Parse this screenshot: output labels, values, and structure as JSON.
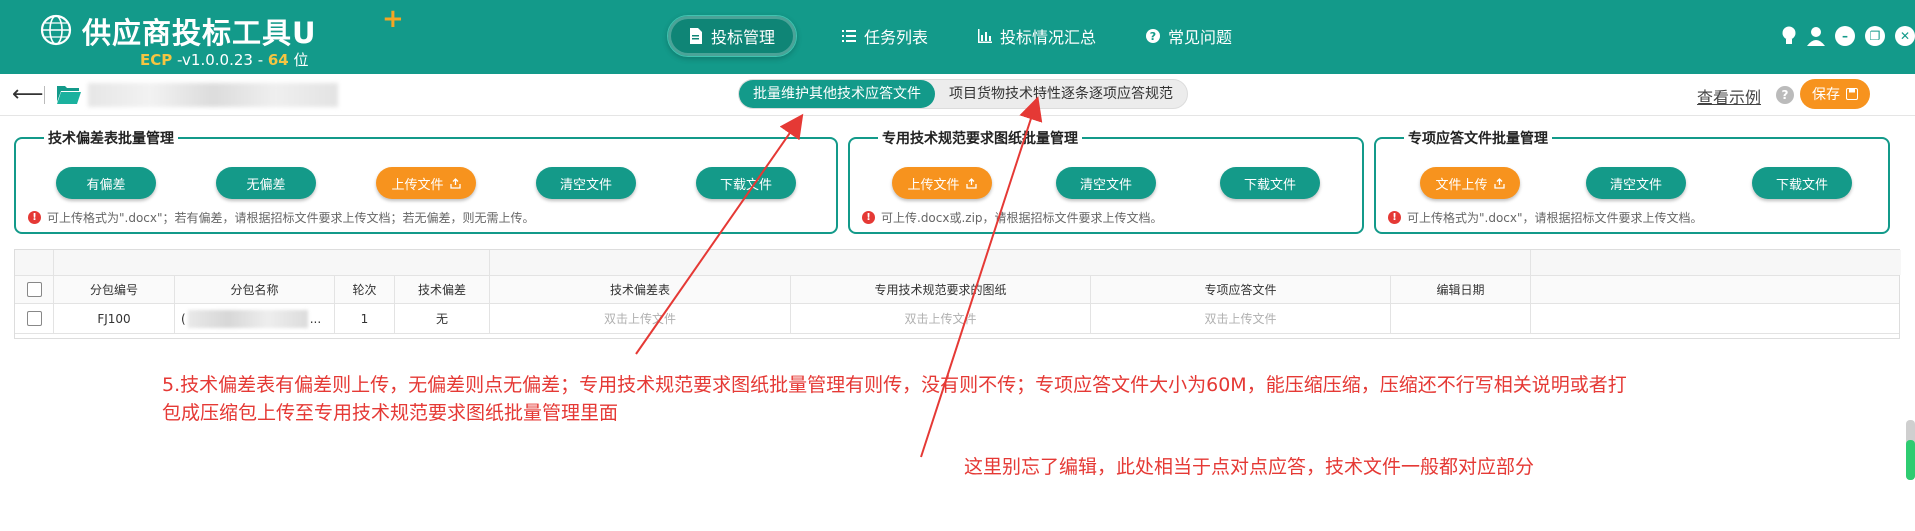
{
  "app": {
    "title": "供应商投标工具U",
    "plus": "+",
    "version_prefix": "ECP",
    "version_number": " -v1.0.0.23 - ",
    "version_bits": "64",
    "version_suffix": " 位"
  },
  "nav": {
    "items": [
      {
        "label": "投标管理",
        "icon": "document-icon"
      },
      {
        "label": "任务列表",
        "icon": "list-icon"
      },
      {
        "label": "投标情况汇总",
        "icon": "bar-chart-icon"
      },
      {
        "label": "常见问题",
        "icon": "question-icon"
      }
    ]
  },
  "toolbar": {
    "tab_active": "批量维护其他技术应答文件",
    "tab_other": "项目货物技术特性逐条逐项应答规范",
    "view_example": "查看示例",
    "save_label": "保存"
  },
  "groups": [
    {
      "title": "技术偏差表批量管理",
      "buttons": [
        "有偏差",
        "无偏差",
        "上传文件",
        "清空文件",
        "下载文件"
      ],
      "note": "可上传格式为\".docx\"；若有偏差，请根据招标文件要求上传文档；若无偏差，则无需上传。"
    },
    {
      "title": "专用技术规范要求图纸批量管理",
      "buttons": [
        "上传文件",
        "清空文件",
        "下载文件"
      ],
      "note": "可上传.docx或.zip，请根据招标文件要求上传文档。"
    },
    {
      "title": "专项应答文件批量管理",
      "buttons": [
        "文件上传",
        "清空文件",
        "下载文件"
      ],
      "note": "可上传格式为\".docx\"，请根据招标文件要求上传文档。"
    }
  ],
  "table": {
    "headers": [
      "分包编号",
      "分包名称",
      "轮次",
      "技术偏差",
      "技术偏差表",
      "专用技术规范要求的图纸",
      "专项应答文件",
      "编辑日期"
    ],
    "rows": [
      {
        "code": "FJ100",
        "name_prefix": "(",
        "name_suffix": "...",
        "round": "1",
        "deviation": "无",
        "deviation_file": "双击上传文件",
        "drawing_file": "双击上传文件",
        "special_file": "双击上传文件",
        "date": ""
      }
    ]
  },
  "annotations": {
    "note1_line1": "5.技术偏差表有偏差则上传，无偏差则点无偏差；专用技术规范要求图纸批量管理有则传，没有则不传；专项应答文件大小为60M，能压缩压缩，压缩还不行写相关说明或者打",
    "note1_line2": "包成压缩包上传至专用技术规范要求图纸批量管理里面",
    "note2": "这里别忘了编辑，此处相当于点对点应答，技术文件一般都对应部分"
  },
  "colors": {
    "primary": "#139a8a",
    "accent": "#f7931e",
    "annotation": "#e53935"
  }
}
